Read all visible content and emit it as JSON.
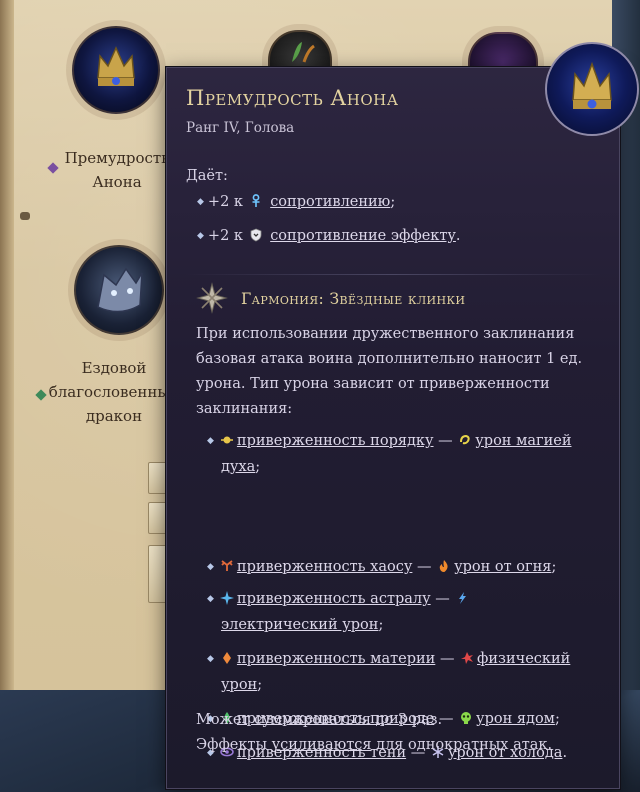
{
  "background": {
    "slots": [
      {
        "label_lines": [
          "Премудрость",
          "Анона"
        ],
        "diamond_color": "#7a4fa0"
      },
      {
        "label_lines": [
          "Ездовой",
          "благословенный",
          "дракон"
        ],
        "diamond_color": "#3d8a5a"
      }
    ]
  },
  "tooltip": {
    "title": "Премудрость Анона",
    "subtitle": "Ранг IV, Голова",
    "gives_label": "Даёт:",
    "bonuses": [
      {
        "prefix": "+2 к",
        "icon": "ankh-icon",
        "link": "сопротивлению",
        "suffix": ";"
      },
      {
        "prefix": "+2 к",
        "icon": "shield-icon",
        "link": "сопротивление эффекту",
        "suffix": "."
      }
    ],
    "harmony": {
      "icon": "crossed-blades-star-icon",
      "title": "Гармония: Звёздные клинки",
      "description_lines": [
        "При использовании дружественного заклинания",
        "базовая атака воина дополнительно наносит 1 ед.",
        "урона. Тип урона зависит от приверженности",
        "заклинания:"
      ],
      "alignments": [
        {
          "icon": "order-icon",
          "alignment": "приверженность порядку",
          "dash": "—",
          "dmg_icon": "spirit-icon",
          "damage_line1": "урон магией",
          "damage_line2": "духа",
          "end": ";"
        },
        {
          "icon": "chaos-icon",
          "alignment": "приверженность хаосу",
          "dash": "—",
          "dmg_icon": "fire-icon",
          "damage_line1": "урон от огня",
          "damage_line2": "",
          "end": ";"
        },
        {
          "icon": "astral-icon",
          "alignment": "приверженность астралу",
          "dash": "—",
          "dmg_icon": "lightning-icon",
          "damage_line1": "",
          "damage_line2": "электрический урон",
          "end": ";"
        },
        {
          "icon": "matter-icon",
          "alignment": "приверженность материи",
          "dash": "—",
          "dmg_icon": "physical-icon",
          "damage_line1": "физический",
          "damage_line2": "урон",
          "end": ";"
        },
        {
          "icon": "nature-icon",
          "alignment": "приверженность природе",
          "dash": "—",
          "dmg_icon": "poison-icon",
          "damage_line1": "урон ядом",
          "damage_line2": "",
          "end": ";"
        },
        {
          "icon": "shadow-icon",
          "alignment": "приверженность тени",
          "dash": "—",
          "dmg_icon": "frost-icon",
          "damage_line1": "урон от холода",
          "damage_line2": "",
          "end": "."
        }
      ],
      "stack_text": "Может суммироваться до 3 раз.",
      "footer_prefix": "Эффекты",
      "footer_link": "усиливаются",
      "footer_suffix": "для однократных атак."
    }
  },
  "colors": {
    "title_gold": "#e3d3a0",
    "tooltip_bg": "#221d33",
    "order": "#e8c64a",
    "chaos": "#e26a3a",
    "astral": "#5ab6ec",
    "matter": "#f08a3c",
    "nature": "#4fc06a",
    "shadow": "#9a7ad8"
  }
}
